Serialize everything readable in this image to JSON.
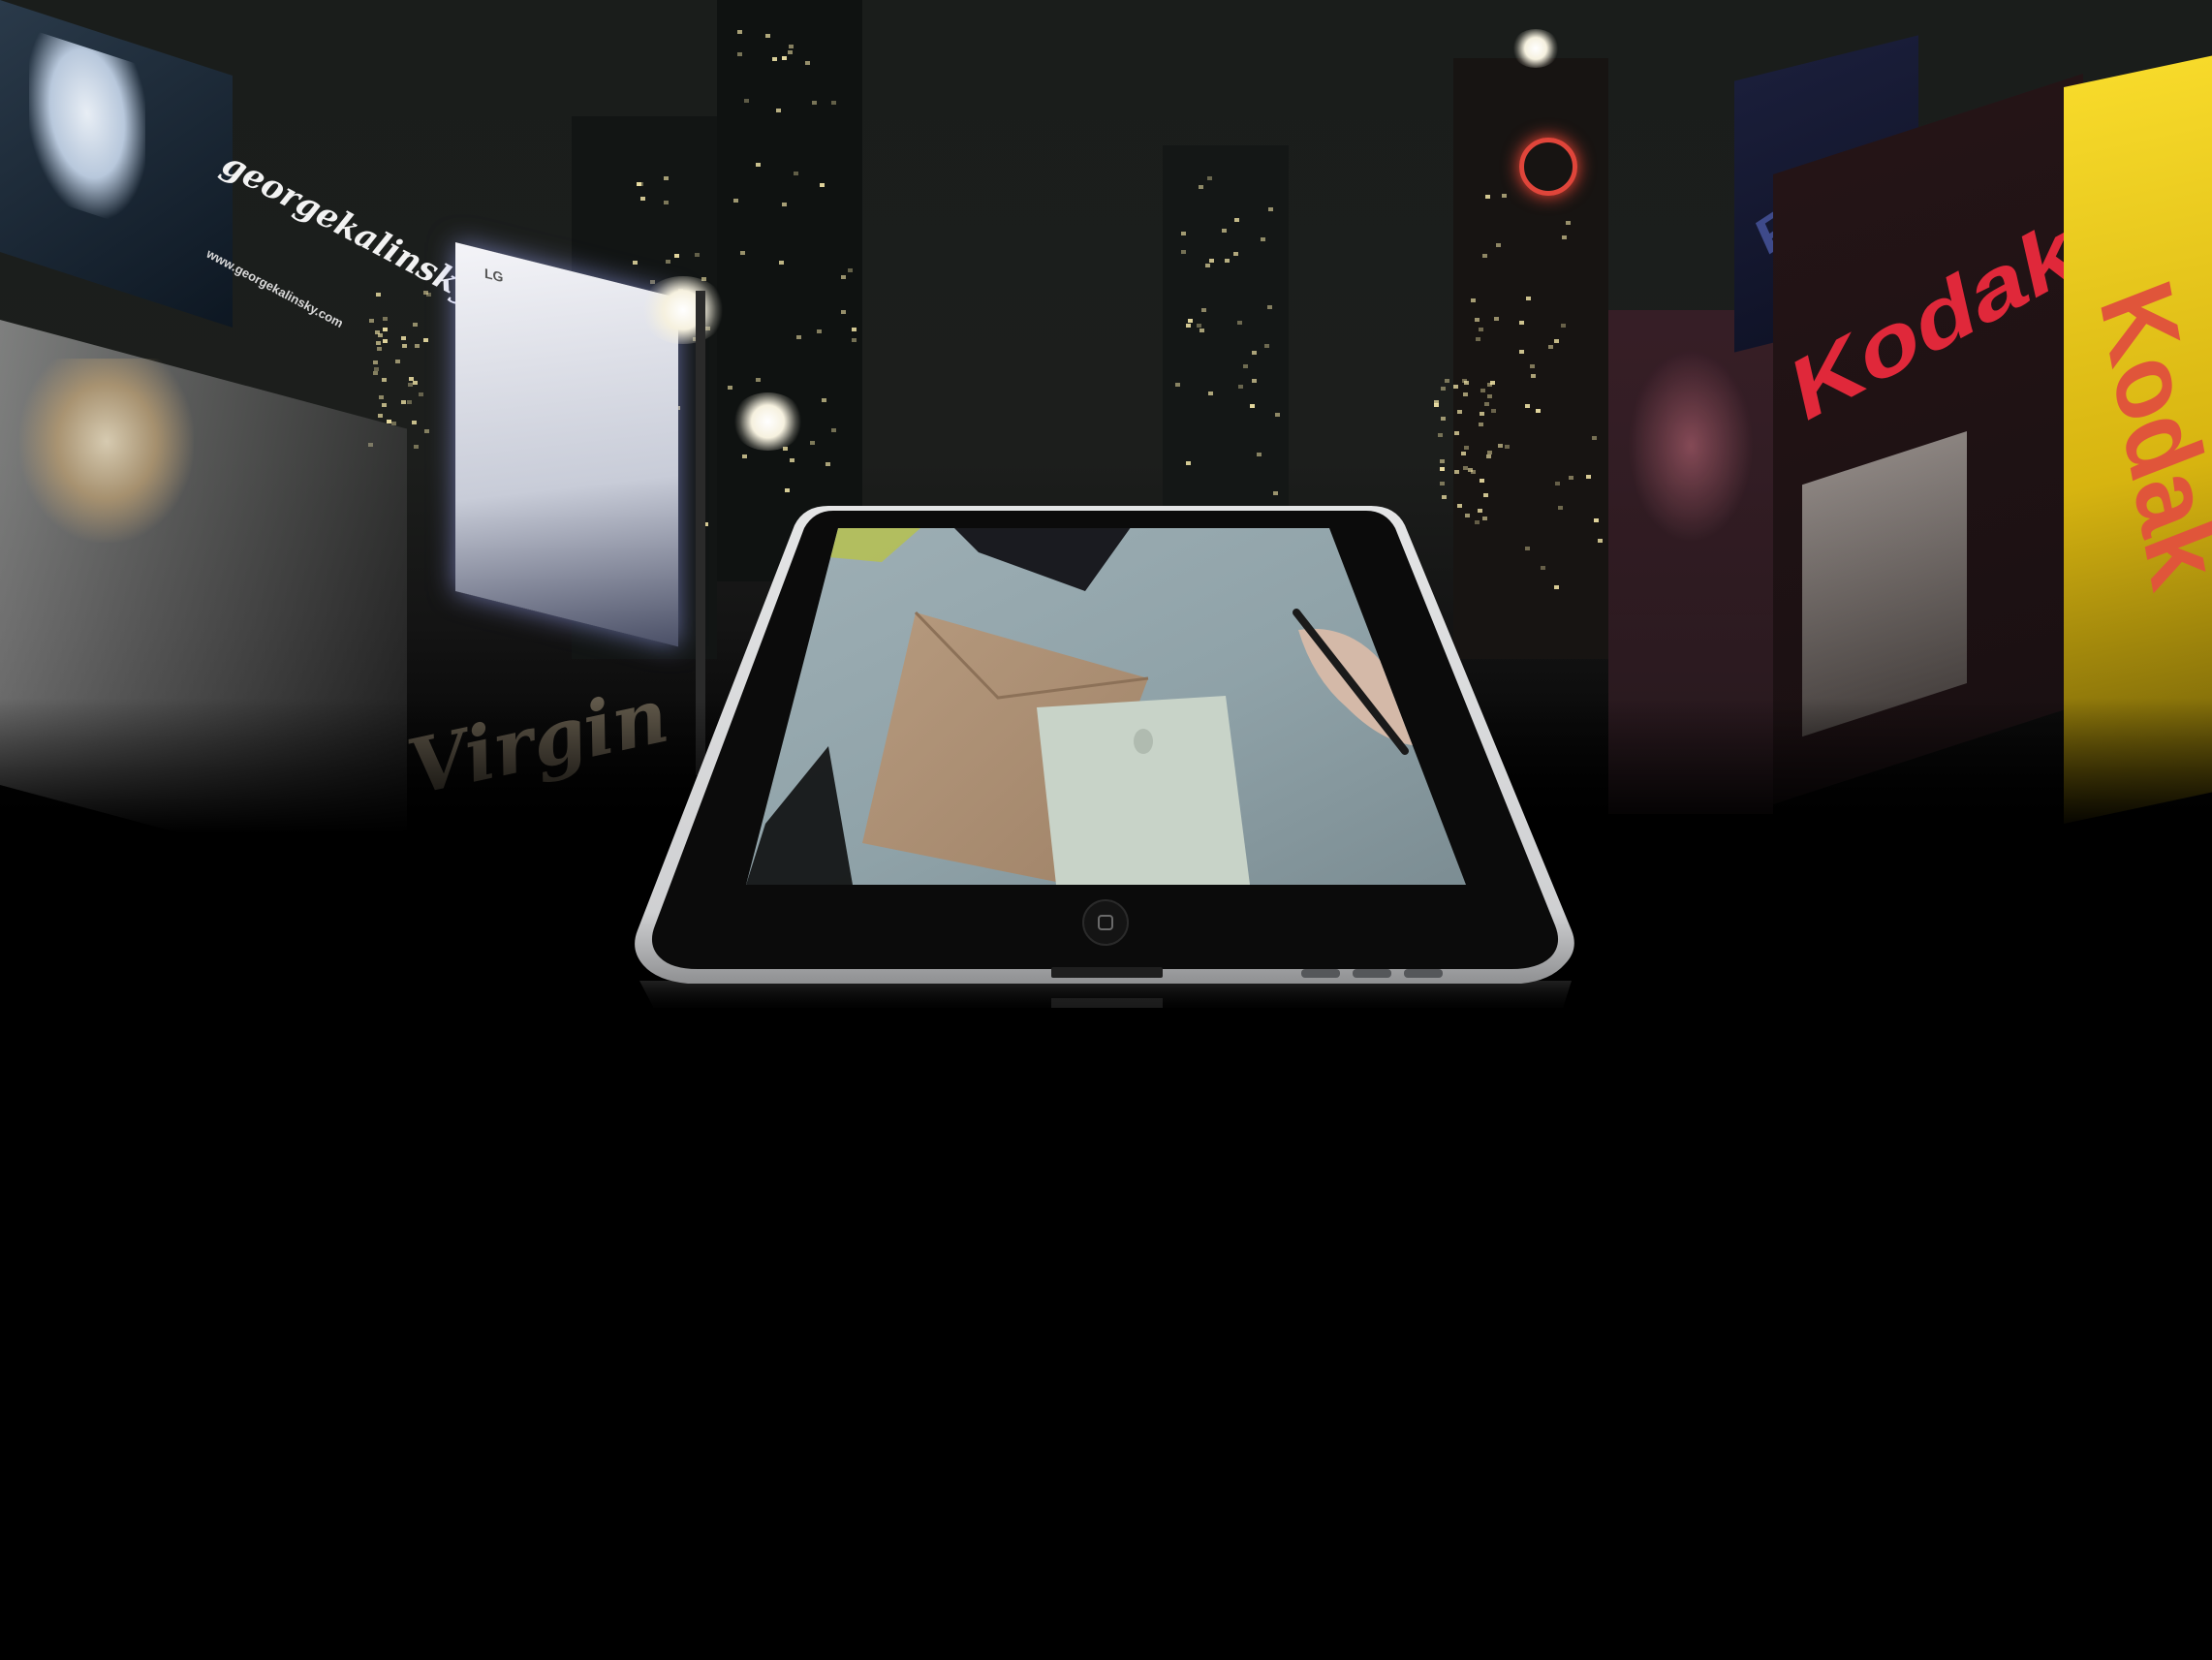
{
  "scene": {
    "background_color": "#000000",
    "sky_color": "#1c1e1c"
  },
  "billboards": {
    "signature_sign": {
      "text": "georgekalinsky",
      "url_text": "www.georgekalinsky.com"
    },
    "kodak_red_sign": {
      "text": "Kodak",
      "color": "#e0283a"
    },
    "kodak_yellow_sign": {
      "text": "Kodak",
      "color": "#f4d020"
    },
    "virgin_sign": {
      "text": "Virgin"
    },
    "lg_sign": {
      "text": "LG"
    },
    "pole_sign": {
      "text": "POLE"
    }
  },
  "tablet": {
    "bezel_color": "#0b0b0b",
    "frame_color": "#d9dadb",
    "home_button_icon": "home-button-icon",
    "screen_image": "desk-with-envelope-and-pen"
  }
}
